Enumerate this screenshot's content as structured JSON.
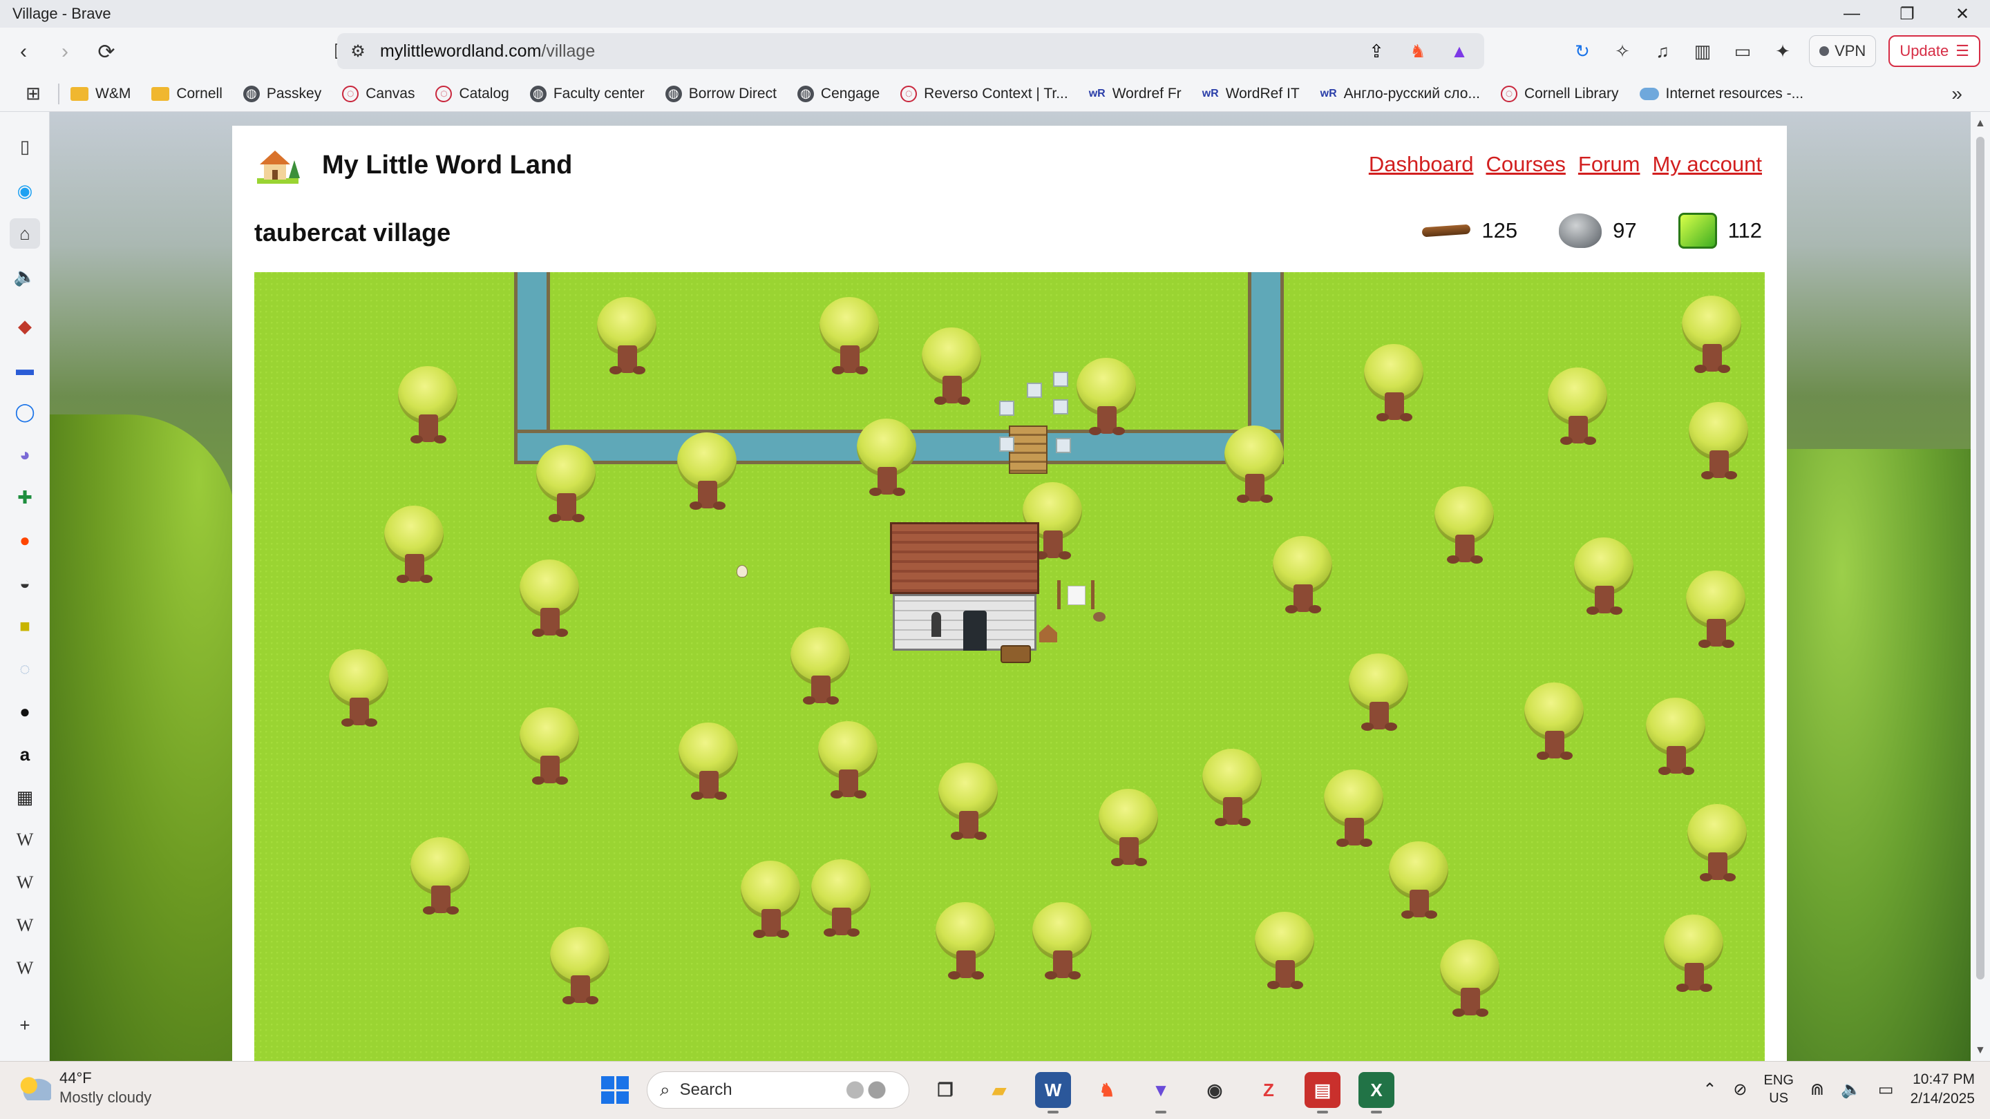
{
  "window": {
    "title": "Village - Brave",
    "controls": [
      "—",
      "❐",
      "✕"
    ]
  },
  "nav": {
    "url_domain": "mylittlewordland.com",
    "url_path": "/village",
    "vpn_label": "VPN",
    "update_label": "Update",
    "shield_badge": "1"
  },
  "bookmarks": [
    {
      "label": "W&M",
      "icon": "folder"
    },
    {
      "label": "Cornell",
      "icon": "folder"
    },
    {
      "label": "Passkey",
      "icon": "globe"
    },
    {
      "label": "Canvas",
      "icon": "red"
    },
    {
      "label": "Catalog",
      "icon": "red"
    },
    {
      "label": "Faculty center",
      "icon": "globe"
    },
    {
      "label": "Borrow Direct",
      "icon": "globe"
    },
    {
      "label": "Cengage",
      "icon": "globe"
    },
    {
      "label": "Reverso Context | Tr...",
      "icon": "red"
    },
    {
      "label": "Wordref Fr",
      "icon": "wr"
    },
    {
      "label": "WordRef IT",
      "icon": "wr"
    },
    {
      "label": "Англо-русский сло...",
      "icon": "wr"
    },
    {
      "label": "Cornell Library",
      "icon": "red"
    },
    {
      "label": "Internet resources -...",
      "icon": "cloud"
    }
  ],
  "site": {
    "title": "My Little Word Land",
    "nav": [
      "Dashboard",
      "Courses",
      "Forum",
      "My account"
    ],
    "village_title": "taubercat village",
    "resources": {
      "wood": "125",
      "stone": "97",
      "energy": "112"
    }
  },
  "taskbar": {
    "temp": "44°F",
    "condition": "Mostly cloudy",
    "search_placeholder": "Search",
    "lang_1": "ENG",
    "lang_2": "US",
    "time": "10:47 PM",
    "date": "2/14/2025"
  },
  "colors": {
    "link_red": "#d21f1f",
    "grass": "#9ad432",
    "river": "#5fa8b8",
    "brave_orange": "#fb542b"
  }
}
